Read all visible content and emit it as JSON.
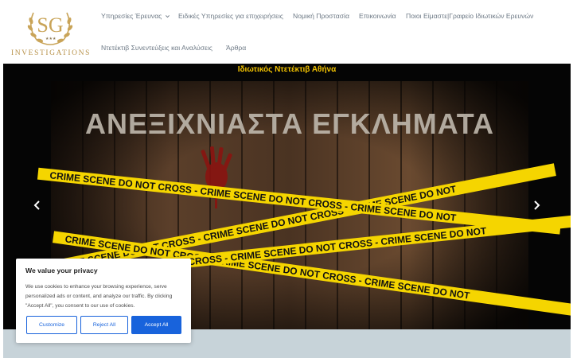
{
  "logo": {
    "monogram": "SG",
    "text": "INVESTIGATIONS"
  },
  "nav": {
    "items": [
      {
        "label": "Υπηρεσίες Έρευνας",
        "has_dropdown": true
      },
      {
        "label": "Ειδικές Υπηρεσίες για επιχειρήσεις"
      },
      {
        "label": "Νομική Προστασία"
      },
      {
        "label": "Επικοινωνία"
      },
      {
        "label": "Ποιοι Είμαστε|Γραφείο Ιδιωτικών Ερευνών"
      },
      {
        "label": "Ντετέκτιβ Συνεντεύξεις και Αναλύσεις"
      },
      {
        "label": "Άρθρα"
      }
    ]
  },
  "hero": {
    "title": "Ιδιωτικός Ντετέκτιβ Αθήνα",
    "image_headline": "ΑΝΕΞΙΧΝΙΑΣΤΑ ΕΓΚΛΗΜΑΤΑ",
    "tape_text": "CRIME SCENE DO NOT CROSS - CRIME SCENE DO NOT CROSS - CRIME SCENE DO NOT",
    "colors": {
      "accent": "#f2c200",
      "tape": "#f5d500"
    }
  },
  "cookie": {
    "title": "We value your privacy",
    "body": "We use cookies to enhance your browsing experience, serve personalized ads or content, and analyze our traffic. By clicking \"Accept All\", you consent to our use of cookies.",
    "customize_label": "Customize",
    "reject_label": "Reject All",
    "accept_label": "Accept All",
    "colors": {
      "primary": "#1863dc"
    }
  }
}
